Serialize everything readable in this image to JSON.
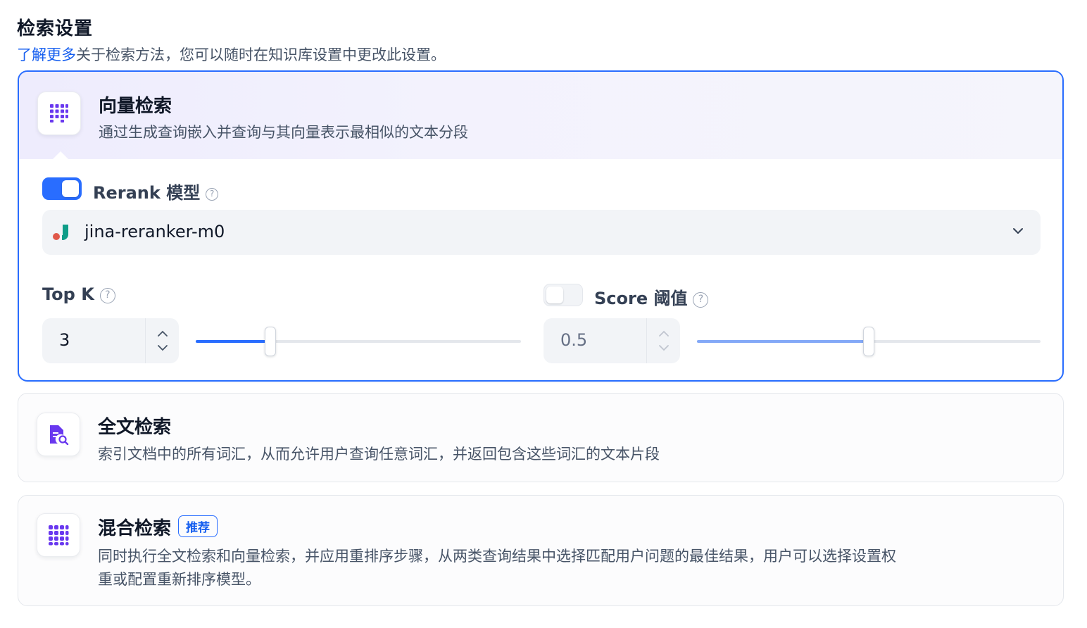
{
  "section": {
    "title": "检索设置",
    "link_text": "了解更多",
    "description": "关于检索方法，您可以随时在知识库设置中更改此设置。"
  },
  "vector_search": {
    "title": "向量检索",
    "description": "通过生成查询嵌入并查询与其向量表示最相似的文本分段",
    "icon": "vector-grid-icon",
    "selected": true,
    "rerank": {
      "enabled": true,
      "label": "Rerank 模型",
      "model": "jina-reranker-m0",
      "help_icon": "?"
    },
    "top_k": {
      "label": "Top K",
      "value": "3",
      "slider_fraction": 0.23,
      "help_icon": "?"
    },
    "score_threshold": {
      "enabled": false,
      "label": "Score 阈值",
      "value": "0.5",
      "slider_fraction": 0.5,
      "help_icon": "?"
    }
  },
  "fulltext_search": {
    "title": "全文检索",
    "description": "索引文档中的所有词汇，从而允许用户查询任意词汇，并返回包含这些词汇的文本片段",
    "icon": "document-search-icon",
    "selected": false
  },
  "hybrid_search": {
    "title": "混合检索",
    "badge": "推荐",
    "description_line1": "同时执行全文检索和向量检索，并应用重排序步骤，从两类查询结果中选择匹配用户问题的最佳结果，用户可以选择设置权",
    "description_line2": "重或配置重新排序模型。",
    "icon": "hybrid-grid-icon",
    "selected": false
  },
  "colors": {
    "accent": "#296dff",
    "link": "#155eef",
    "icon_purple": "#6938ef"
  }
}
